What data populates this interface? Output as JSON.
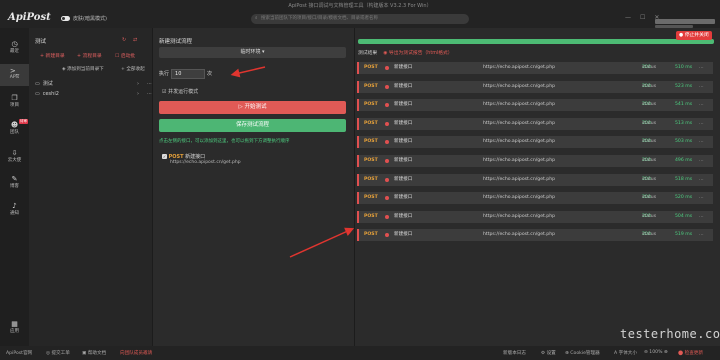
{
  "window": {
    "title": "ApiPost 接口调试与文档管理工具（构建版本 V3.2.3 For Win）"
  },
  "header": {
    "logo": "ApiPost",
    "theme_label": "皮肤(暗黑模式)",
    "search_placeholder": "搜索当前团队下的项目/接口/目录/模板文档、目录或者名称"
  },
  "rail": {
    "items": [
      {
        "label": "最近",
        "icon": "clock-icon"
      },
      {
        "label": "APIs",
        "icon": "terminal-icon"
      },
      {
        "label": "项目",
        "icon": "folder-icon"
      },
      {
        "label": "团队",
        "icon": "team-icon",
        "badge": "待审"
      },
      {
        "label": "云大使",
        "icon": "download-icon"
      },
      {
        "label": "博客",
        "icon": "pencil-icon"
      },
      {
        "label": "通知",
        "icon": "bell-icon"
      },
      {
        "label": "应用",
        "icon": "grid-icon"
      }
    ]
  },
  "tree": {
    "title": "测试",
    "new_dir": "+ 新建目录",
    "import_dir": "+ 流程目录",
    "delete_test": "☐ 启动批",
    "add_subdir": "添加到当前目录下",
    "collapse": "全部收起",
    "items": [
      {
        "label": "测试"
      },
      {
        "label": "ceshi2"
      }
    ]
  },
  "run": {
    "title": "新建测试流程",
    "env_select": "临时环境 ▾",
    "exec_label": "执行",
    "exec_value": "10",
    "exec_unit": "次",
    "concurrent_label": "☑ 并发运行模式",
    "start_button": "▷ 开始测试",
    "save_button": "保存测试流程",
    "hint": "点击左侧的接口，可以添加到这里，也可以拖到下方调整执行顺序",
    "api": {
      "method": "POST",
      "name": "新建接口",
      "url": "https://echo.apipost.cn/get.php"
    }
  },
  "results": {
    "stop_button": "● 停止并关闭",
    "header_title": "测试结果",
    "header_link": "◉ 导出为测试报告（html格式）",
    "rows": [
      {
        "method": "POST",
        "name": "新建接口",
        "url": "https://echo.apipost.cn/get.php",
        "status": "200",
        "time": "510 ms",
        "size": "…"
      },
      {
        "method": "POST",
        "name": "新建接口",
        "url": "https://echo.apipost.cn/get.php",
        "status": "200",
        "time": "523 ms",
        "size": "…"
      },
      {
        "method": "POST",
        "name": "新建接口",
        "url": "https://echo.apipost.cn/get.php",
        "status": "200",
        "time": "541 ms",
        "size": "…"
      },
      {
        "method": "POST",
        "name": "新建接口",
        "url": "https://echo.apipost.cn/get.php",
        "status": "200",
        "time": "513 ms",
        "size": "…"
      },
      {
        "method": "POST",
        "name": "新建接口",
        "url": "https://echo.apipost.cn/get.php",
        "status": "200",
        "time": "503 ms",
        "size": "…"
      },
      {
        "method": "POST",
        "name": "新建接口",
        "url": "https://echo.apipost.cn/get.php",
        "status": "200",
        "time": "496 ms",
        "size": "…"
      },
      {
        "method": "POST",
        "name": "新建接口",
        "url": "https://echo.apipost.cn/get.php",
        "status": "200",
        "time": "518 ms",
        "size": "…"
      },
      {
        "method": "POST",
        "name": "新建接口",
        "url": "https://echo.apipost.cn/get.php",
        "status": "200",
        "time": "520 ms",
        "size": "…"
      },
      {
        "method": "POST",
        "name": "新建接口",
        "url": "https://echo.apipost.cn/get.php",
        "status": "200",
        "time": "504 ms",
        "size": "…"
      },
      {
        "method": "POST",
        "name": "新建接口",
        "url": "https://echo.apipost.cn/get.php",
        "status": "200",
        "time": "519 ms",
        "size": "…"
      }
    ],
    "status_prefix": "status"
  },
  "statusbar": {
    "left": [
      "ApiPost官网",
      "◎ 提交工单",
      "▣ 帮助文档",
      "向团队成员邀请"
    ],
    "right": [
      "新版本日志",
      "⚙ 设置",
      "⊕ Cookie管理器",
      "A 字体大小",
      "⊖ 100% ⊕",
      "⬤ 检查更新"
    ]
  },
  "watermark": "testerhome.com"
}
